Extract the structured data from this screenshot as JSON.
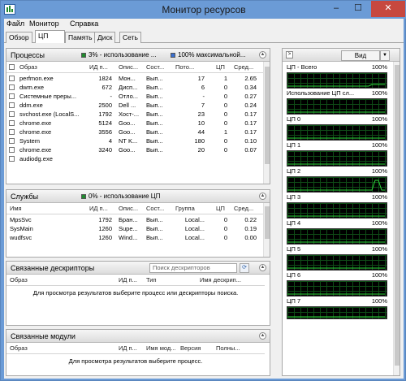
{
  "window": {
    "title": "Монитор ресурсов",
    "minimize": "–",
    "maximize": "☐",
    "close": "✕"
  },
  "menu": [
    "Файл",
    "Монитор",
    "Справка"
  ],
  "tabs": [
    "Обзор",
    "ЦП",
    "Память",
    "Диск",
    "Сеть"
  ],
  "processes": {
    "title": "Процессы",
    "usage": "3% - использование ...",
    "max": "100% максимальной...",
    "columns": [
      "Образ",
      "ИД п...",
      "Опис...",
      "Сост...",
      "Пото...",
      "ЦП",
      "Сред..."
    ],
    "rows": [
      [
        "perfmon.exe",
        "1824",
        "Мон...",
        "Вып...",
        "17",
        "1",
        "2.65"
      ],
      [
        "dwm.exe",
        "672",
        "Дисп...",
        "Вып...",
        "6",
        "0",
        "0.34"
      ],
      [
        "Системные преры...",
        "-",
        "Отло...",
        "Вып...",
        "-",
        "0",
        "0.27"
      ],
      [
        "ddm.exe",
        "2500",
        "Dell ...",
        "Вып...",
        "7",
        "0",
        "0.24"
      ],
      [
        "svchost.exe (LocalS...",
        "1792",
        "Хост-...",
        "Вып...",
        "23",
        "0",
        "0.17"
      ],
      [
        "chrome.exe",
        "5124",
        "Goo...",
        "Вып...",
        "10",
        "0",
        "0.17"
      ],
      [
        "chrome.exe",
        "3556",
        "Goo...",
        "Вып...",
        "44",
        "1",
        "0.17"
      ],
      [
        "System",
        "4",
        "NT K...",
        "Вып...",
        "180",
        "0",
        "0.10"
      ],
      [
        "chrome.exe",
        "3240",
        "Goo...",
        "Вып...",
        "20",
        "0",
        "0.07"
      ],
      [
        "audiodg.exe",
        "",
        "",
        "",
        "",
        "",
        ""
      ]
    ]
  },
  "services": {
    "title": "Службы",
    "usage": "0% - использование ЦП",
    "columns": [
      "Имя",
      "ИД п...",
      "Опис...",
      "Сост...",
      "Группа",
      "ЦП",
      "Сред..."
    ],
    "rows": [
      [
        "MpsSvc",
        "1792",
        "Бран...",
        "Вып...",
        "Local...",
        "0",
        "0.22"
      ],
      [
        "SysMain",
        "1260",
        "Supe...",
        "Вып...",
        "Local...",
        "0",
        "0.19"
      ],
      [
        "wudfsvc",
        "1260",
        "Wind...",
        "Вып...",
        "Local...",
        "0",
        "0.00"
      ]
    ]
  },
  "handles": {
    "title": "Связанные дескрипторы",
    "search_placeholder": "Поиск дескрипторов",
    "columns": [
      "Образ",
      "ИД п...",
      "Тип",
      "Имя дескрип..."
    ],
    "hint": "Для просмотра результатов выберите процесс или дескрипторы поиска."
  },
  "modules": {
    "title": "Связанные модули",
    "columns": [
      "Образ",
      "ИД п...",
      "Имя мод...",
      "Версия",
      "Полны..."
    ],
    "hint": "Для просмотра результатов выберите процесс."
  },
  "right": {
    "view_label": "Вид",
    "graphs": [
      {
        "name": "ЦП - Всего",
        "pct": "100%"
      },
      {
        "name": "Использование ЦП сл...",
        "pct": "100%"
      },
      {
        "name": "ЦП 0",
        "pct": "100%"
      },
      {
        "name": "ЦП 1",
        "pct": "100%"
      },
      {
        "name": "ЦП 2",
        "pct": "100%"
      },
      {
        "name": "ЦП 3",
        "pct": "100%"
      },
      {
        "name": "ЦП 4",
        "pct": "100%"
      },
      {
        "name": "ЦП 5",
        "pct": "100%"
      },
      {
        "name": "ЦП 6",
        "pct": "100%"
      },
      {
        "name": "ЦП 7",
        "pct": "100%"
      }
    ]
  },
  "colors": {
    "green": "#1f8a2e",
    "blue": "#3a6fd0",
    "graph_bg": "#000000",
    "graph_grid": "#0f4d17",
    "graph_line": "#2cd33a"
  }
}
